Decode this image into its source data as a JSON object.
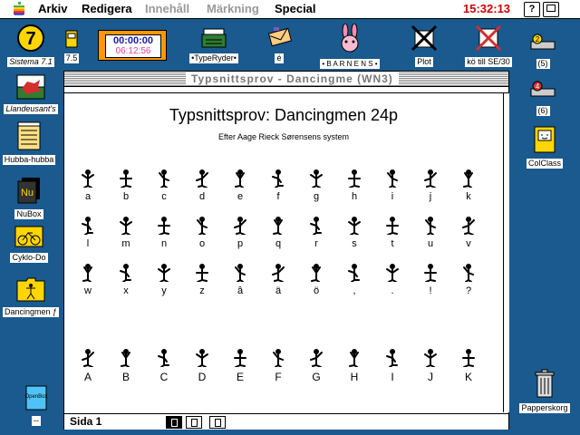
{
  "menubar": {
    "apple": "apple-menu",
    "items": [
      {
        "label": "Arkiv",
        "enabled": true
      },
      {
        "label": "Redigera",
        "enabled": true
      },
      {
        "label": "Innehåll",
        "enabled": false
      },
      {
        "label": "Märkning",
        "enabled": false
      },
      {
        "label": "Special",
        "enabled": true
      }
    ],
    "clock": "15:32:13",
    "help": "?"
  },
  "desktop": {
    "left_icons": [
      {
        "label": "Sistema 7.1",
        "icon": "sistema-7-icon"
      },
      {
        "label": "Llandeusant's",
        "icon": "welsh-flag-icon"
      },
      {
        "label": "Hubba-hubba",
        "icon": "notepad-icon"
      },
      {
        "label": "NuBox",
        "icon": "nubox-icon"
      },
      {
        "label": "Cyklo-Do",
        "icon": "cyklo-icon"
      },
      {
        "label": "Dancingmen ƒ",
        "icon": "folder-dancing-icon"
      },
      {
        "label": "--",
        "icon": "openbox-icon"
      }
    ],
    "top_icons": [
      {
        "label": "7.5",
        "icon": "control-panel-icon"
      },
      {
        "label": "06:12:56",
        "icon": "timer-icon",
        "main": "00:00:00"
      },
      {
        "label": "•TypeRyder•",
        "icon": "typewriter-icon"
      },
      {
        "label": "é",
        "icon": "envelope-icon"
      },
      {
        "label": "• B A R N E N S •",
        "icon": "bunny-icon"
      },
      {
        "label": "Plot",
        "icon": "plot-icon"
      },
      {
        "label": "kö till SE/30",
        "icon": "queue-icon"
      }
    ],
    "right_icons": [
      {
        "label": "(5)",
        "icon": "drive-icon",
        "badge": "2"
      },
      {
        "label": "(6)",
        "icon": "drive-icon",
        "badge": "4"
      },
      {
        "label": "ColClass",
        "icon": "classic-mac-icon"
      },
      {
        "label": "Papperskorg",
        "icon": "trash-icon"
      }
    ]
  },
  "window": {
    "title": "Typsnittsprov - Dancingme (WN3)",
    "status": "Sida  1",
    "document": {
      "heading": "Typsnittsprov: Dancingmen 24p",
      "subheading": "Efter Aage Rieck Sørensens system",
      "rows": [
        [
          "a",
          "b",
          "c",
          "d",
          "e",
          "f",
          "g",
          "h",
          "i",
          "j",
          "k"
        ],
        [
          "l",
          "m",
          "n",
          "o",
          "p",
          "q",
          "r",
          "s",
          "t",
          "u",
          "v"
        ],
        [
          "w",
          "x",
          "y",
          "z",
          "â",
          "ä",
          "ö",
          ",",
          ".",
          "!",
          "?"
        ],
        [
          "A",
          "B",
          "C",
          "D",
          "E",
          "F",
          "G",
          "H",
          "I",
          "J",
          "K"
        ]
      ]
    }
  }
}
